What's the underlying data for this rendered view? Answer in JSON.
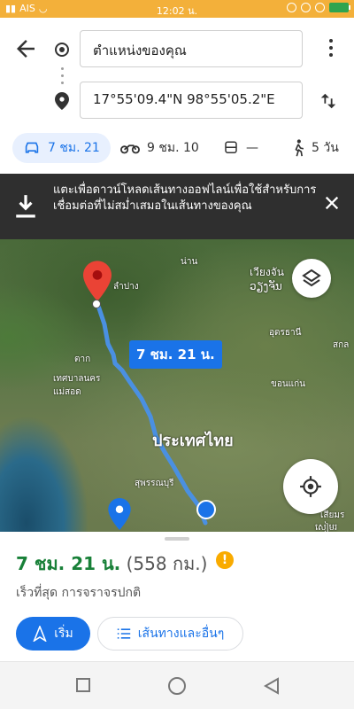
{
  "status_bar": {
    "carrier": "AIS",
    "time": "12:02 น."
  },
  "route": {
    "origin_value": "ตำแหน่งของคุณ",
    "destination_value": "17°55'09.4\"N 98°55'05.2\"E"
  },
  "modes": [
    {
      "name": "car",
      "duration": "7 ชม. 21"
    },
    {
      "name": "motorcycle",
      "duration": "9 ชม. 10"
    },
    {
      "name": "transit",
      "duration": "—"
    },
    {
      "name": "walk",
      "duration": "5 วัน"
    }
  ],
  "banner": {
    "text": "แตะเพื่อดาวน์โหลดเส้นทางออฟไลน์เพื่อใช้สำหรับการเชื่อมต่อที่ไม่สม่ำเสมอในเส้นทางของคุณ"
  },
  "map": {
    "labels": {
      "nan": "น่าน",
      "lampang": "ลำปาง",
      "vientiane": "เวียงจัน",
      "vientiane2": "ວຽງຈັນ",
      "udon": "อุดรธานี",
      "sakon": "สกล",
      "tak": "ตาก",
      "maesot": "เทศบาลนคร แม่สอด",
      "khonkaen": "ขอนแก่น",
      "thailand": "ประเทศไทย",
      "suphan": "สุพรรณบุรี",
      "siemreap": "เสียมร",
      "siemreap2": "សៀមរ"
    },
    "route_badge": "7 ชม. 21 น."
  },
  "summary": {
    "eta": "7 ชม. 21 น.",
    "distance": "(558 กม.)",
    "warning": "!",
    "description": "เร็วที่สุด การจราจรปกติ",
    "start_label": "เริ่ม",
    "steps_label": "เส้นทางและอื่นๆ"
  },
  "colors": {
    "accent": "#1a73e8",
    "eta_green": "#188038",
    "status_bar": "#f3b03a",
    "route": "#4a90e2"
  }
}
